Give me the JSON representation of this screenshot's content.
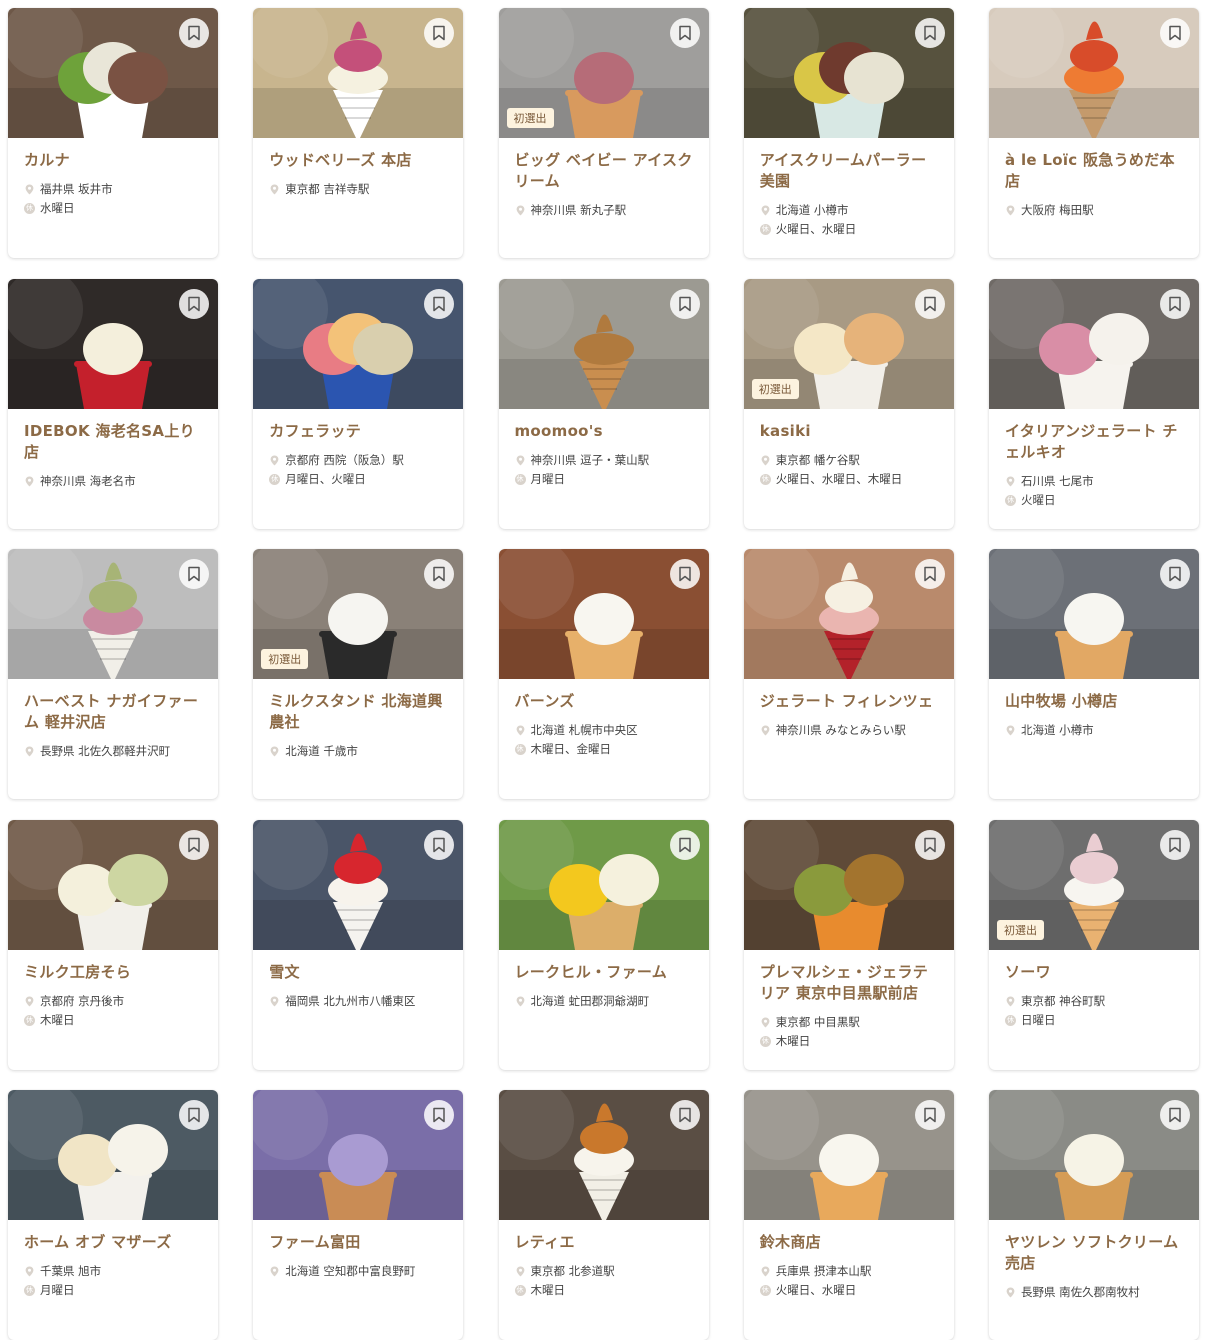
{
  "colors": {
    "title": "#8c6a46",
    "meta_text": "#444444",
    "badge_bg": "#fdf3df",
    "card_bg": "#ffffff"
  },
  "icons": {
    "bookmark": "bookmark-icon",
    "location": "location-pin-icon",
    "closed": "closed-day-icon"
  },
  "closed_glyph": "休",
  "shops": [
    {
      "name": "カルナ",
      "location": "福井県 坂井市",
      "closed": "水曜日",
      "badge": "",
      "photo": {
        "bg": "#6e5848",
        "cup": "#ffffff",
        "scoops": [
          "#6ea23a",
          "#e9e6d8",
          "#7a5243"
        ]
      }
    },
    {
      "name": "ウッドベリーズ 本店",
      "location": "東京都 吉祥寺駅",
      "closed": "",
      "badge": "",
      "photo": {
        "bg": "#c8b58e",
        "cup": "#ffffff",
        "scoops": [
          "#f5f1e0",
          "#c4507a"
        ]
      }
    },
    {
      "name": "ビッグ ベイビー アイスクリーム",
      "location": "神奈川県 新丸子駅",
      "closed": "",
      "badge": "初選出",
      "photo": {
        "bg": "#9f9e9c",
        "cup": "#d89a5e",
        "scoops": [
          "#b66c78"
        ]
      }
    },
    {
      "name": "アイスクリームパーラー美園",
      "location": "北海道 小樽市",
      "closed": "火曜日、水曜日",
      "badge": "",
      "photo": {
        "bg": "#57523e",
        "cup": "#d8e8e4",
        "scoops": [
          "#d9c647",
          "#6f3a2e",
          "#e7e3d2"
        ]
      }
    },
    {
      "name": "à le Loïc 阪急うめだ本店",
      "location": "大阪府 梅田駅",
      "closed": "",
      "badge": "",
      "photo": {
        "bg": "#d7cbbd",
        "cup": "#c49a6c",
        "scoops": [
          "#ee7b33",
          "#d84c2a"
        ]
      }
    },
    {
      "name": "IDEBOK 海老名SA上り店",
      "location": "神奈川県 海老名市",
      "closed": "",
      "badge": "",
      "photo": {
        "bg": "#2f2a28",
        "cup": "#c4202c",
        "scoops": [
          "#f4efdc"
        ]
      }
    },
    {
      "name": "カフェラッテ",
      "location": "京都府 西院（阪急）駅",
      "closed": "月曜日、火曜日",
      "badge": "",
      "photo": {
        "bg": "#46556e",
        "cup": "#2b55b0",
        "scoops": [
          "#e87c84",
          "#f3c279",
          "#d9cfae"
        ]
      }
    },
    {
      "name": "moomoo's",
      "location": "神奈川県 逗子・葉山駅",
      "closed": "月曜日",
      "badge": "",
      "photo": {
        "bg": "#9c9a92",
        "cup": "#c98e4f",
        "scoops": [
          "#b07a3e"
        ]
      }
    },
    {
      "name": "kasiki",
      "location": "東京都 幡ケ谷駅",
      "closed": "火曜日、水曜日、木曜日",
      "badge": "初選出",
      "photo": {
        "bg": "#a89a84",
        "cup": "#f2efe9",
        "scoops": [
          "#f4e7c6",
          "#e6b37a"
        ]
      }
    },
    {
      "name": "イタリアンジェラート チェルキオ",
      "location": "石川県 七尾市",
      "closed": "火曜日",
      "badge": "",
      "photo": {
        "bg": "#6f6a66",
        "cup": "#f6f3ee",
        "scoops": [
          "#d98ea6",
          "#f5f2ec"
        ]
      }
    },
    {
      "name": "ハーベスト ナガイファーム 軽井沢店",
      "location": "長野県 北佐久郡軽井沢町",
      "closed": "",
      "badge": "",
      "photo": {
        "bg": "#bdbdbd",
        "cup": "#f1efe8",
        "scoops": [
          "#c98aa0",
          "#a7b476"
        ]
      }
    },
    {
      "name": "ミルクスタンド 北海道興農社",
      "location": "北海道 千歳市",
      "closed": "",
      "badge": "初選出",
      "photo": {
        "bg": "#8a8178",
        "cup": "#2a2a2a",
        "scoops": [
          "#f6f5f1"
        ]
      }
    },
    {
      "name": "バーンズ",
      "location": "北海道 札幌市中央区",
      "closed": "木曜日、金曜日",
      "badge": "",
      "photo": {
        "bg": "#8a4f33",
        "cup": "#e7b06a",
        "scoops": [
          "#f8f6f0"
        ]
      }
    },
    {
      "name": "ジェラート フィレンツェ",
      "location": "神奈川県 みなとみらい駅",
      "closed": "",
      "badge": "",
      "photo": {
        "bg": "#b98a6c",
        "cup": "#b3222a",
        "scoops": [
          "#eab5b0",
          "#f6f0e2"
        ]
      }
    },
    {
      "name": "山中牧場 小樽店",
      "location": "北海道 小樽市",
      "closed": "",
      "badge": "",
      "photo": {
        "bg": "#6c7077",
        "cup": "#e2a864",
        "scoops": [
          "#f7f6f1"
        ]
      }
    },
    {
      "name": "ミルク工房そら",
      "location": "京都府 京丹後市",
      "closed": "木曜日",
      "badge": "",
      "photo": {
        "bg": "#705a48",
        "cup": "#f2f0ea",
        "scoops": [
          "#f4f0dc",
          "#cdd6a2"
        ]
      }
    },
    {
      "name": "雪文",
      "location": "福岡県 北九州市八幡東区",
      "closed": "",
      "badge": "",
      "photo": {
        "bg": "#4a5568",
        "cup": "#f5f3ef",
        "scoops": [
          "#f7f3ec",
          "#d7262e"
        ]
      }
    },
    {
      "name": "レークヒル・ファーム",
      "location": "北海道 虻田郡洞爺湖町",
      "closed": "",
      "badge": "",
      "photo": {
        "bg": "#6f9a48",
        "cup": "#dcae6a",
        "scoops": [
          "#f3c81e",
          "#f5f1dd"
        ]
      }
    },
    {
      "name": "プレマルシェ・ジェラテリア 東京中目黒駅前店",
      "location": "東京都 中目黒駅",
      "closed": "木曜日",
      "badge": "",
      "photo": {
        "bg": "#5f4a38",
        "cup": "#e88b2e",
        "scoops": [
          "#8a9a3c",
          "#a3742e"
        ]
      }
    },
    {
      "name": "ソーワ",
      "location": "東京都 神谷町駅",
      "closed": "日曜日",
      "badge": "初選出",
      "photo": {
        "bg": "#6e6e6e",
        "cup": "#e9b271",
        "scoops": [
          "#f7f5f0",
          "#eacdd2"
        ]
      }
    },
    {
      "name": "ホーム オブ マザーズ",
      "location": "千葉県 旭市",
      "closed": "月曜日",
      "badge": "",
      "photo": {
        "bg": "#4d5a63",
        "cup": "#f3f1ec",
        "scoops": [
          "#f1e5c6",
          "#f6f3ea"
        ]
      }
    },
    {
      "name": "ファーム富田",
      "location": "北海道 空知郡中富良野町",
      "closed": "",
      "badge": "",
      "photo": {
        "bg": "#7a6ea8",
        "cup": "#c98c55",
        "scoops": [
          "#a99bd2"
        ]
      }
    },
    {
      "name": "レティエ",
      "location": "東京都 北参道駅",
      "closed": "木曜日",
      "badge": "",
      "photo": {
        "bg": "#5a4e44",
        "cup": "#f2efe6",
        "scoops": [
          "#f7f4ec",
          "#c9782c"
        ]
      }
    },
    {
      "name": "鈴木商店",
      "location": "兵庫県 摂津本山駅",
      "closed": "火曜日、水曜日",
      "badge": "",
      "photo": {
        "bg": "#97938b",
        "cup": "#e8a95c",
        "scoops": [
          "#f8f6ee"
        ]
      }
    },
    {
      "name": "ヤツレン ソフトクリーム売店",
      "location": "長野県 南佐久郡南牧村",
      "closed": "",
      "badge": "",
      "photo": {
        "bg": "#8a8b86",
        "cup": "#d59c55",
        "scoops": [
          "#f6f3e6"
        ]
      }
    }
  ]
}
